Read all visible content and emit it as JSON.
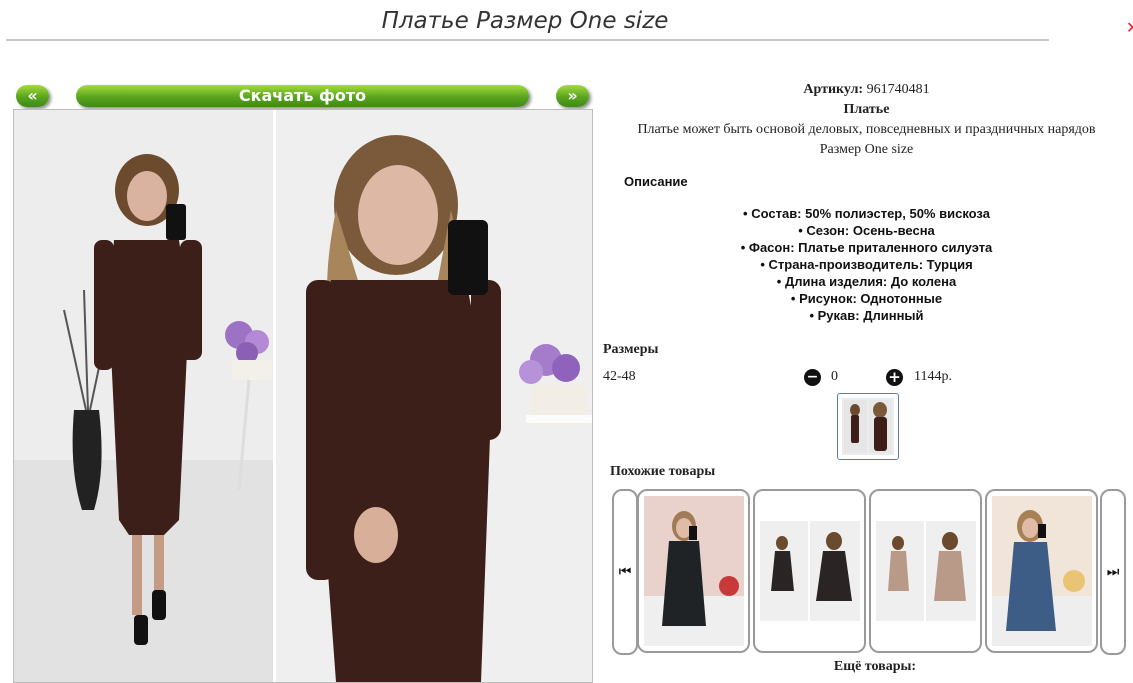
{
  "header": {
    "title": "Платье Размер One size",
    "close_glyph": "✕"
  },
  "gallery": {
    "prev_label": "«",
    "next_label": "»",
    "download_label": "Скачать фото",
    "photos": [
      {
        "name": "product-photo-full-length",
        "colors": {
          "background": "#eeeeee",
          "dress": "#3d1f1a",
          "hair": "#6b4a2e"
        }
      },
      {
        "name": "product-photo-closeup",
        "colors": {
          "background": "#efefef",
          "dress": "#3d1f1a",
          "hair": "#7a5a3a"
        }
      }
    ]
  },
  "product": {
    "article_label": "Артикул:",
    "article_value": "961740481",
    "name": "Платье",
    "tagline": "Платье может быть основой деловых, повседневных и праздничных нарядов",
    "size_text": "Размер One size",
    "description_title": "Описание",
    "features": [
      "Состав: 50% полиэстер, 50% вискоза",
      "Сезон: Осень-весна",
      "Фасон: Платье приталенного силуэта",
      "Страна-производитель: Турция",
      "Длина изделия: До колена",
      "Рисунок: Однотонные",
      "Рукав: Длинный"
    ]
  },
  "sizes": {
    "title": "Размеры",
    "rows": [
      {
        "size": "42-48",
        "minus_icon": "minus-circle-icon",
        "quantity": "0",
        "plus_icon": "plus-circle-icon",
        "price": "1144р."
      }
    ]
  },
  "similar": {
    "title": "Похожие товары",
    "prev_icon": "first-page-icon",
    "next_icon": "last-page-icon",
    "prev_glyph": "⏮",
    "next_glyph": "⏭",
    "items": [
      {
        "name": "similar-item-black-dress",
        "dress_color": "#1f2326"
      },
      {
        "name": "similar-item-dark-dress-pair",
        "dress_color": "#2b2424"
      },
      {
        "name": "similar-item-beige-dress-pair",
        "dress_color": "#b99a88"
      },
      {
        "name": "similar-item-blue-dress",
        "dress_color": "#3d5c86"
      }
    ],
    "more_label": "Ещё товары:"
  },
  "colors": {
    "accent_green": "#5aa41e",
    "title_line": "#c9c9c9",
    "close": "#d8202e"
  }
}
